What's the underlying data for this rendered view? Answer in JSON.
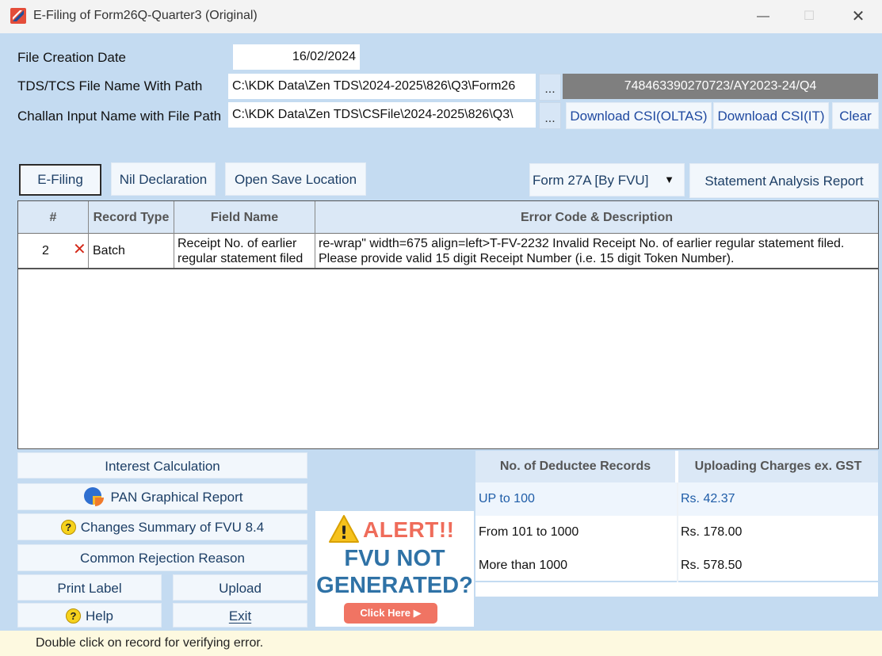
{
  "window": {
    "title": "E-Filing of Form26Q-Quarter3 (Original)",
    "min_symbol": "—",
    "max_symbol": "☐",
    "close_symbol": "✕"
  },
  "form": {
    "file_creation_date_label": "File Creation Date",
    "file_creation_date": "16/02/2024",
    "tds_file_label": "TDS/TCS File Name With Path",
    "tds_file_path": "C:\\KDK Data\\Zen TDS\\2024-2025\\826\\Q3\\Form26",
    "challan_label": "Challan Input Name with File Path",
    "challan_path": "C:\\KDK Data\\Zen TDS\\CSFile\\2024-2025\\826\\Q3\\",
    "browse_label": "...",
    "token_value": "748463390270723/AY2023-24/Q4",
    "download_csi_oltas": "Download CSI(OLTAS)",
    "download_csi_it": "Download CSI(IT)",
    "clear": "Clear"
  },
  "toolbar": {
    "efiling": "E-Filing",
    "nil_declaration": "Nil Declaration",
    "open_save_location": "Open Save Location",
    "form_select": "Form 27A [By FVU]",
    "statement_analysis": "Statement Analysis Report"
  },
  "grid": {
    "columns": [
      "#",
      "Record Type",
      "Field Name",
      "Error Code & Description"
    ],
    "rows": [
      {
        "num": "2",
        "record_type": "Batch",
        "field_name_line1": "Receipt No. of earlier",
        "field_name_line2": "regular statement filed",
        "desc_line1": "re-wrap\" width=675 align=left>T-FV-2232 Invalid Receipt No. of earlier regular statement filed.",
        "desc_line2": "Please provide valid 15 digit Receipt Number (i.e. 15 digit Token Number)."
      }
    ]
  },
  "bottom_buttons": {
    "interest_calculation": "Interest Calculation",
    "pan_graphical_report": "PAN Graphical Report",
    "changes_summary": "Changes Summary of FVU 8.4",
    "common_rejection": "Common Rejection Reason",
    "print_label": "Print Label",
    "upload": "Upload",
    "help": "Help",
    "exit": "Exit",
    "help_glyph": "?"
  },
  "alert": {
    "title": "ALERT!!",
    "line1": "FVU NOT",
    "line2": "GENERATED?",
    "click_here": "Click Here ▶",
    "warn_glyph": "!"
  },
  "charges": {
    "headers": [
      "No. of Deductee Records",
      "Uploading Charges ex. GST"
    ],
    "rows": [
      {
        "range": "UP to 100",
        "charge": "Rs. 42.37"
      },
      {
        "range": "From 101 to 1000",
        "charge": "Rs. 178.00"
      },
      {
        "range": "More than 1000",
        "charge": "Rs. 578.50"
      }
    ]
  },
  "status": {
    "message": "Double click on record for verifying error."
  },
  "colors": {
    "window_bg": "#c4dbf1",
    "header_bg": "#dbe8f6",
    "link_blue": "#1f49a0",
    "alert_red": "#ef6c5a",
    "alert_blue": "#2f72a6",
    "error_red": "#d42a1a",
    "highlight_row_text": "#1f5da8"
  }
}
